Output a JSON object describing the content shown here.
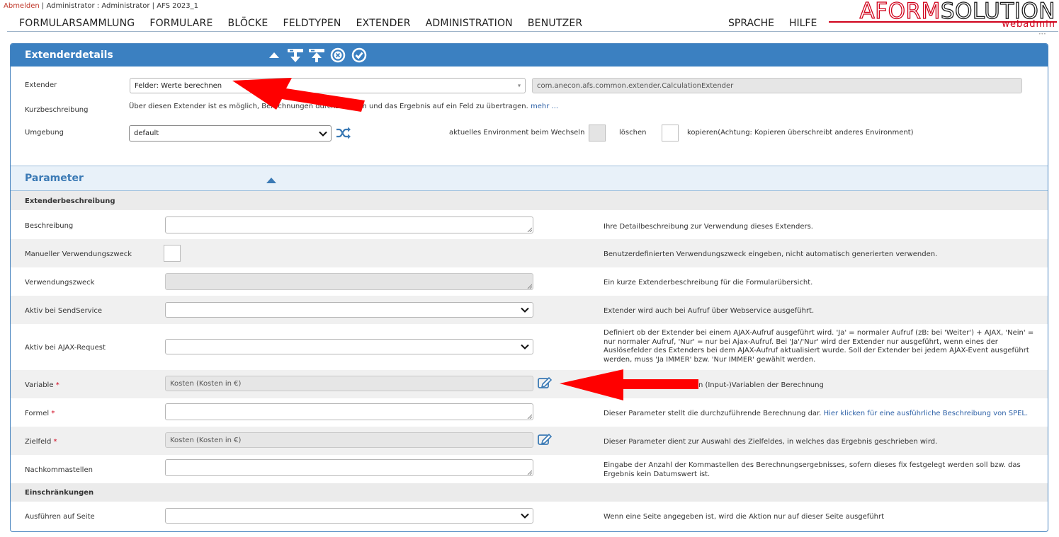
{
  "header": {
    "logout": "Abmelden",
    "userinfo": "| Administrator : Administrator | AFS 2023_1",
    "nav": [
      "FORMULARSAMMLUNG",
      "FORMULARE",
      "BLÖCKE",
      "FELDTYPEN",
      "EXTENDER",
      "ADMINISTRATION",
      "BENUTZER"
    ],
    "nav_right": [
      "SPRACHE",
      "HILFE"
    ],
    "logo_a": "AFORM",
    "logo_b": "SOLUTION",
    "logo_sub": "webadmin"
  },
  "details": {
    "title": "Extenderdetails",
    "toolbar_icons": [
      "collapse-up-icon",
      "import-down-icon",
      "export-up-icon",
      "cancel-circle-icon",
      "confirm-check-icon"
    ],
    "extender_label": "Extender",
    "extender_value": "Felder: Werte berechnen",
    "extender_class": "com.anecon.afs.common.extender.CalculationExtender",
    "kurz_label": "Kurzbeschreibung",
    "kurz_text": "Über diesen Extender ist es möglich, Berechnungen durchzuführen und das Ergebnis auf ein Feld zu übertragen.",
    "kurz_more": "mehr ...",
    "umgebung_label": "Umgebung",
    "umgebung_value": "default",
    "env_text": "aktuelles Environment beim Wechseln",
    "loeschen": "löschen",
    "kopieren": "kopieren(Achtung: Kopieren überschreibt anderes Environment)"
  },
  "parameter": {
    "title": "Parameter",
    "section1": "Extenderbeschreibung",
    "section2": "Einschränkungen",
    "rows": {
      "beschreibung": {
        "label": "Beschreibung",
        "desc": "Ihre Detailbeschreibung zur Verwendung dieses Extenders."
      },
      "manuell": {
        "label": "Manueller Verwendungszweck",
        "desc": "Benutzerdefinierten Verwendungszweck eingeben, nicht automatisch generierten verwenden."
      },
      "zweck": {
        "label": "Verwendungszweck",
        "desc": "Ein kurze Extenderbeschreibung für die Formularübersicht."
      },
      "send": {
        "label": "Aktiv bei SendService",
        "desc": "Extender wird auch bei Aufruf über Webservice ausgeführt."
      },
      "ajax": {
        "label": "Aktiv bei AJAX-Request",
        "desc": "Definiert ob der Extender bei einem AJAX-Aufruf ausgeführt wird. 'Ja' = normaler Aufruf (zB: bei 'Weiter') + AJAX, 'Nein' = nur normaler Aufruf, 'Nur' = nur bei Ajax-Aufruf. Bei 'Ja'/'Nur' wird der Extender nur ausgeführt, wenn eines der Auslösefelder des Extenders bei dem AJAX-Aufruf aktualisiert wurde. Soll der Extender bei jedem AJAX-Event ausgeführt werden, muss 'Ja IMMER' bzw. 'Nur IMMER' gewählt werden."
      },
      "variable": {
        "label": "Variable",
        "value": "Kosten (Kosten in €)",
        "desc": "nt den (Input-)Variablen der Berechnung"
      },
      "formel": {
        "label": "Formel",
        "desc": "Dieser Parameter stellt die durchzuführende Berechnung dar.",
        "link": "Hier klicken für eine ausführliche Beschreibung von SPEL."
      },
      "zielfeld": {
        "label": "Zielfeld",
        "value": "Kosten (Kosten in €)",
        "desc": "Dieser Parameter dient zur Auswahl des Zielfeldes, in welches das Ergebnis geschrieben wird."
      },
      "nachkomma": {
        "label": "Nachkommastellen",
        "desc": "Eingabe der Anzahl der Kommastellen des Berechnungsergebnisses, sofern dieses fix festgelegt werden soll bzw. das Ergebnis kein Datumswert ist."
      },
      "seite": {
        "label": "Ausführen auf Seite",
        "desc": "Wenn eine Seite angegeben ist, wird die Aktion nur auf dieser Seite ausgeführt"
      }
    },
    "required_mark": "*"
  },
  "colors": {
    "accent": "#3b80c1",
    "arrow": "#ff0000",
    "brand_red": "#d0021b"
  }
}
